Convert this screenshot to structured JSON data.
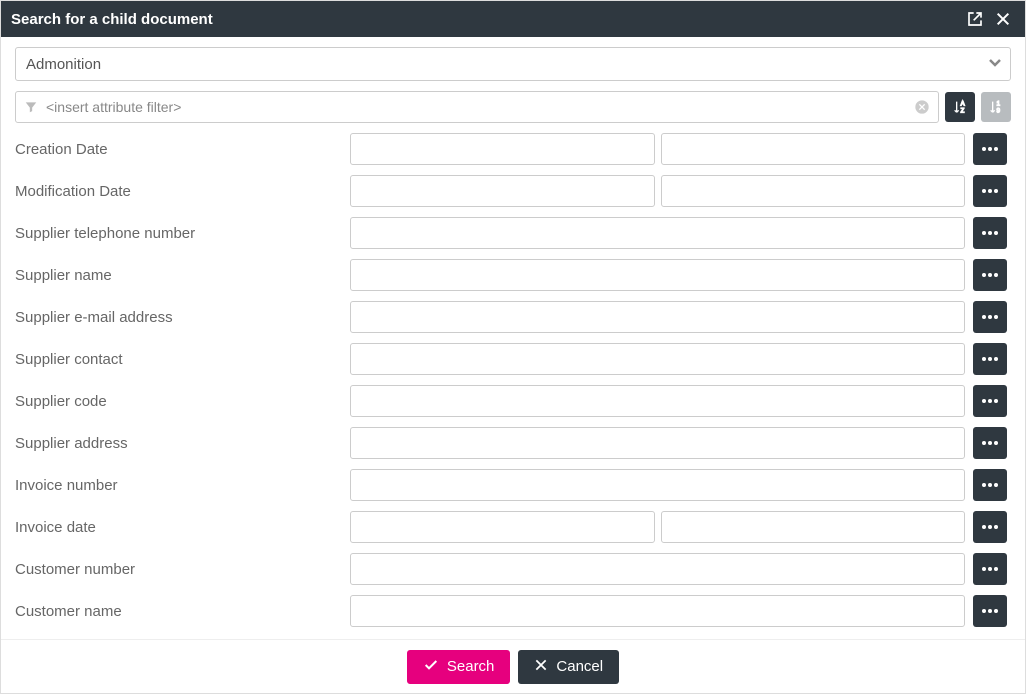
{
  "title": "Search for a child document",
  "doctype_selected": "Admonition",
  "filter_placeholder": "<insert attribute filter>",
  "fields": [
    {
      "label": "Creation Date",
      "kind": "range"
    },
    {
      "label": "Modification Date",
      "kind": "range"
    },
    {
      "label": "Supplier telephone number",
      "kind": "single"
    },
    {
      "label": "Supplier name",
      "kind": "single"
    },
    {
      "label": "Supplier e-mail address",
      "kind": "single"
    },
    {
      "label": "Supplier contact",
      "kind": "single"
    },
    {
      "label": "Supplier code",
      "kind": "single"
    },
    {
      "label": "Supplier address",
      "kind": "single"
    },
    {
      "label": "Invoice number",
      "kind": "single"
    },
    {
      "label": "Invoice date",
      "kind": "range"
    },
    {
      "label": "Customer number",
      "kind": "single"
    },
    {
      "label": "Customer name",
      "kind": "single"
    }
  ],
  "buttons": {
    "search": "Search",
    "cancel": "Cancel"
  }
}
